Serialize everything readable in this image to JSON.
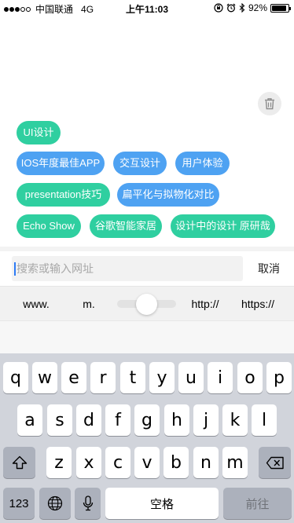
{
  "status_bar": {
    "carrier": "中国联通",
    "network": "4G",
    "time": "上午11:03",
    "battery": "92%",
    "battery_level": 0.92,
    "icons": [
      "signal-dots-icon",
      "orientation-lock-icon",
      "alarm-icon",
      "bluetooth-icon",
      "battery-icon"
    ]
  },
  "history": {
    "clear_icon": "trash-icon",
    "tags": [
      {
        "label": "UI设计",
        "color": "#2fcfa0"
      },
      {
        "label": "IOS年度最佳APP",
        "color": "#4ea2f2"
      },
      {
        "label": "交互设计",
        "color": "#4ea2f2"
      },
      {
        "label": "用户体验",
        "color": "#4ea2f2"
      },
      {
        "label": "presentation技巧",
        "color": "#2fcfa0"
      },
      {
        "label": "扁平化与拟物化对比",
        "color": "#4ea2f2"
      },
      {
        "label": "Echo Show",
        "color": "#2fcfa0"
      },
      {
        "label": "谷歌智能家居",
        "color": "#2fcfa0"
      },
      {
        "label": "设计中的设计 原研哉",
        "color": "#2fcfa0"
      }
    ]
  },
  "search": {
    "placeholder": "搜索或输入网址",
    "cancel_label": "取消"
  },
  "quick_inputs": {
    "items": [
      "www.",
      "m.",
      "http://",
      "https://"
    ]
  },
  "keyboard": {
    "row1": [
      "q",
      "w",
      "e",
      "r",
      "t",
      "y",
      "u",
      "i",
      "o",
      "p"
    ],
    "row2": [
      "a",
      "s",
      "d",
      "f",
      "g",
      "h",
      "j",
      "k",
      "l"
    ],
    "row3": [
      "z",
      "x",
      "c",
      "v",
      "b",
      "n",
      "m"
    ],
    "numbers_label": "123",
    "space_label": "空格",
    "go_label": "前往",
    "icons": [
      "shift-icon",
      "delete-icon",
      "globe-icon",
      "microphone-icon"
    ]
  }
}
